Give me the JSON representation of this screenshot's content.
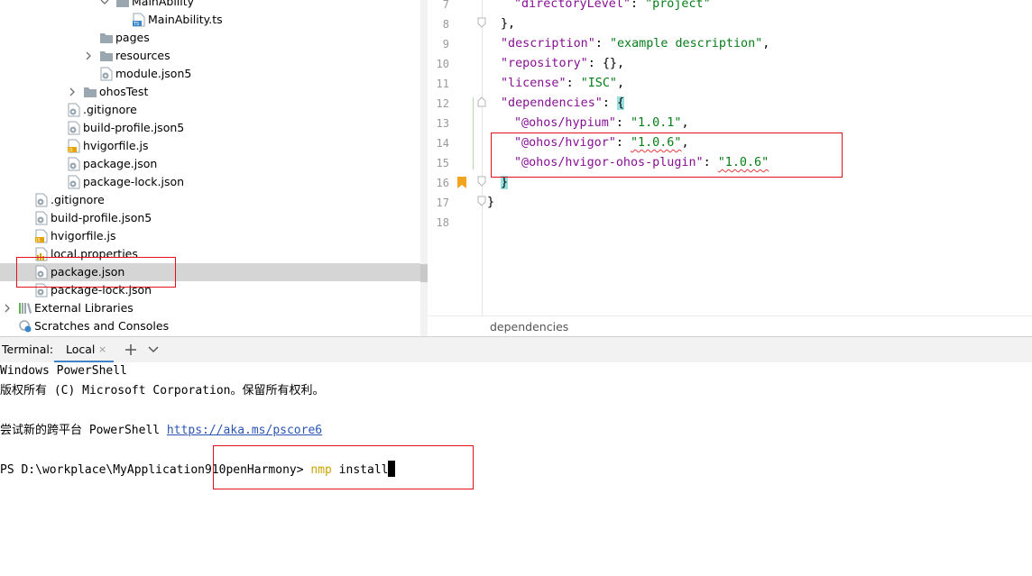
{
  "tree": {
    "items": [
      {
        "label": "MainAbility",
        "type": "folder",
        "arrow": "down"
      },
      {
        "label": "MainAbility.ts",
        "type": "ts"
      },
      {
        "label": "pages",
        "type": "folder",
        "arrow": "right"
      },
      {
        "label": "resources",
        "type": "folder",
        "arrow": "right"
      },
      {
        "label": "module.json5",
        "type": "json"
      },
      {
        "label": "ohosTest",
        "type": "folder",
        "arrow": "right"
      },
      {
        "label": ".gitignore",
        "type": "config"
      },
      {
        "label": "build-profile.json5",
        "type": "json"
      },
      {
        "label": "hvigorfile.js",
        "type": "js"
      },
      {
        "label": "package.json",
        "type": "json"
      },
      {
        "label": "package-lock.json",
        "type": "json"
      },
      {
        "label": ".gitignore",
        "type": "config"
      },
      {
        "label": "build-profile.json5",
        "type": "json"
      },
      {
        "label": "hvigorfile.js",
        "type": "js"
      },
      {
        "label": "local.properties",
        "type": "properties"
      },
      {
        "label": "package.json",
        "type": "json",
        "selected": true
      },
      {
        "label": "package-lock.json",
        "type": "json"
      },
      {
        "label": "External Libraries",
        "type": "libraries",
        "arrow": "right"
      },
      {
        "label": "Scratches and Consoles",
        "type": "scratches"
      }
    ]
  },
  "editor": {
    "line_numbers": [
      "7",
      "8",
      "9",
      "10",
      "11",
      "12",
      "13",
      "14",
      "15",
      "16",
      "17",
      "18"
    ],
    "lines": {
      "l7": {
        "key": "\"directoryLevel\"",
        "sep": ": ",
        "val": "\"project\""
      },
      "l8": {
        "text": "},"
      },
      "l9": {
        "key": "\"description\"",
        "sep": ": ",
        "val": "\"example description\"",
        "end": ","
      },
      "l10": {
        "key": "\"repository\"",
        "sep": ": ",
        "val": "{}",
        "end": ","
      },
      "l11": {
        "key": "\"license\"",
        "sep": ": ",
        "val": "\"ISC\"",
        "end": ","
      },
      "l12": {
        "key": "\"dependencies\"",
        "sep": ": ",
        "val": "{"
      },
      "l13": {
        "key": "\"@ohos/hypium\"",
        "sep": ": ",
        "val": "\"1.0.1\"",
        "end": ","
      },
      "l14": {
        "key": "\"@ohos/hvigor\"",
        "sep": ": ",
        "val": "\"1.0.6\"",
        "end": ","
      },
      "l15": {
        "key": "\"@ohos/hvigor-ohos-plugin\"",
        "sep": ": ",
        "val": "\"1.0.6\""
      },
      "l16": {
        "text": "}"
      },
      "l17": {
        "text": "}"
      }
    },
    "breadcrumb": "dependencies"
  },
  "terminal": {
    "title": "Terminal:",
    "tab_label": "Local",
    "close_glyph": "×",
    "lines": {
      "l1": "Windows PowerShell",
      "l2": "版权所有 (C) Microsoft Corporation。保留所有权利。",
      "l4_prefix": "尝试新的跨平台 PowerShell ",
      "l4_link": "https://aka.ms/pscore6",
      "prompt": "PS D:\\workplace\\MyApplication910penHarmony> ",
      "cmd": "nmp",
      "arg": " install"
    }
  },
  "colors": {
    "annotation": "#e0101f",
    "selection": "#d5d5d5",
    "json_key": "#871094",
    "json_string": "#067d17",
    "link": "#2a55b4",
    "command": "#c9a400",
    "tab_accent": "#4083c9"
  }
}
